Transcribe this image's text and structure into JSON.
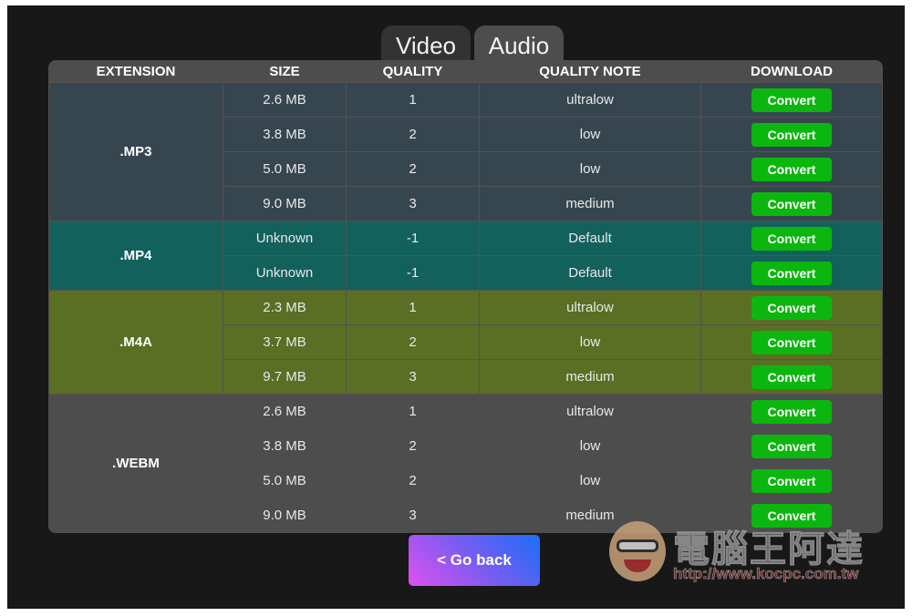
{
  "tabs": [
    {
      "label": "Video",
      "active": false
    },
    {
      "label": "Audio",
      "active": true
    }
  ],
  "table": {
    "headers": [
      "EXTENSION",
      "SIZE",
      "QUALITY",
      "QUALITY NOTE",
      "DOWNLOAD"
    ],
    "groups": [
      {
        "extension": ".MP3",
        "color": "#36464f",
        "rows": [
          {
            "size": "2.6 MB",
            "quality": "1",
            "note": "ultralow",
            "action": "Convert"
          },
          {
            "size": "3.8 MB",
            "quality": "2",
            "note": "low",
            "action": "Convert"
          },
          {
            "size": "5.0 MB",
            "quality": "2",
            "note": "low",
            "action": "Convert"
          },
          {
            "size": "9.0 MB",
            "quality": "3",
            "note": "medium",
            "action": "Convert"
          }
        ]
      },
      {
        "extension": ".MP4",
        "color": "#13615d",
        "rows": [
          {
            "size": "Unknown",
            "quality": "-1",
            "note": "Default",
            "action": "Convert"
          },
          {
            "size": "Unknown",
            "quality": "-1",
            "note": "Default",
            "action": "Convert"
          }
        ]
      },
      {
        "extension": ".M4A",
        "color": "#5a6e24",
        "rows": [
          {
            "size": "2.3 MB",
            "quality": "1",
            "note": "ultralow",
            "action": "Convert"
          },
          {
            "size": "3.7 MB",
            "quality": "2",
            "note": "low",
            "action": "Convert"
          },
          {
            "size": "9.7 MB",
            "quality": "3",
            "note": "medium",
            "action": "Convert"
          }
        ]
      },
      {
        "extension": ".WEBM",
        "color": "#4d4d4d",
        "rows": [
          {
            "size": "2.6 MB",
            "quality": "1",
            "note": "ultralow",
            "action": "Convert"
          },
          {
            "size": "3.8 MB",
            "quality": "2",
            "note": "low",
            "action": "Convert"
          },
          {
            "size": "5.0 MB",
            "quality": "2",
            "note": "low",
            "action": "Convert"
          },
          {
            "size": "9.0 MB",
            "quality": "3",
            "note": "medium",
            "action": "Convert"
          }
        ]
      }
    ]
  },
  "go_back_label": "< Go back",
  "colors": {
    "convert_button": "#0bb70e",
    "go_back_start": "#e050f0",
    "go_back_end": "#1a6ef8"
  },
  "watermark": {
    "title": "電腦王阿達",
    "url": "http://www.kocpc.com.tw"
  }
}
